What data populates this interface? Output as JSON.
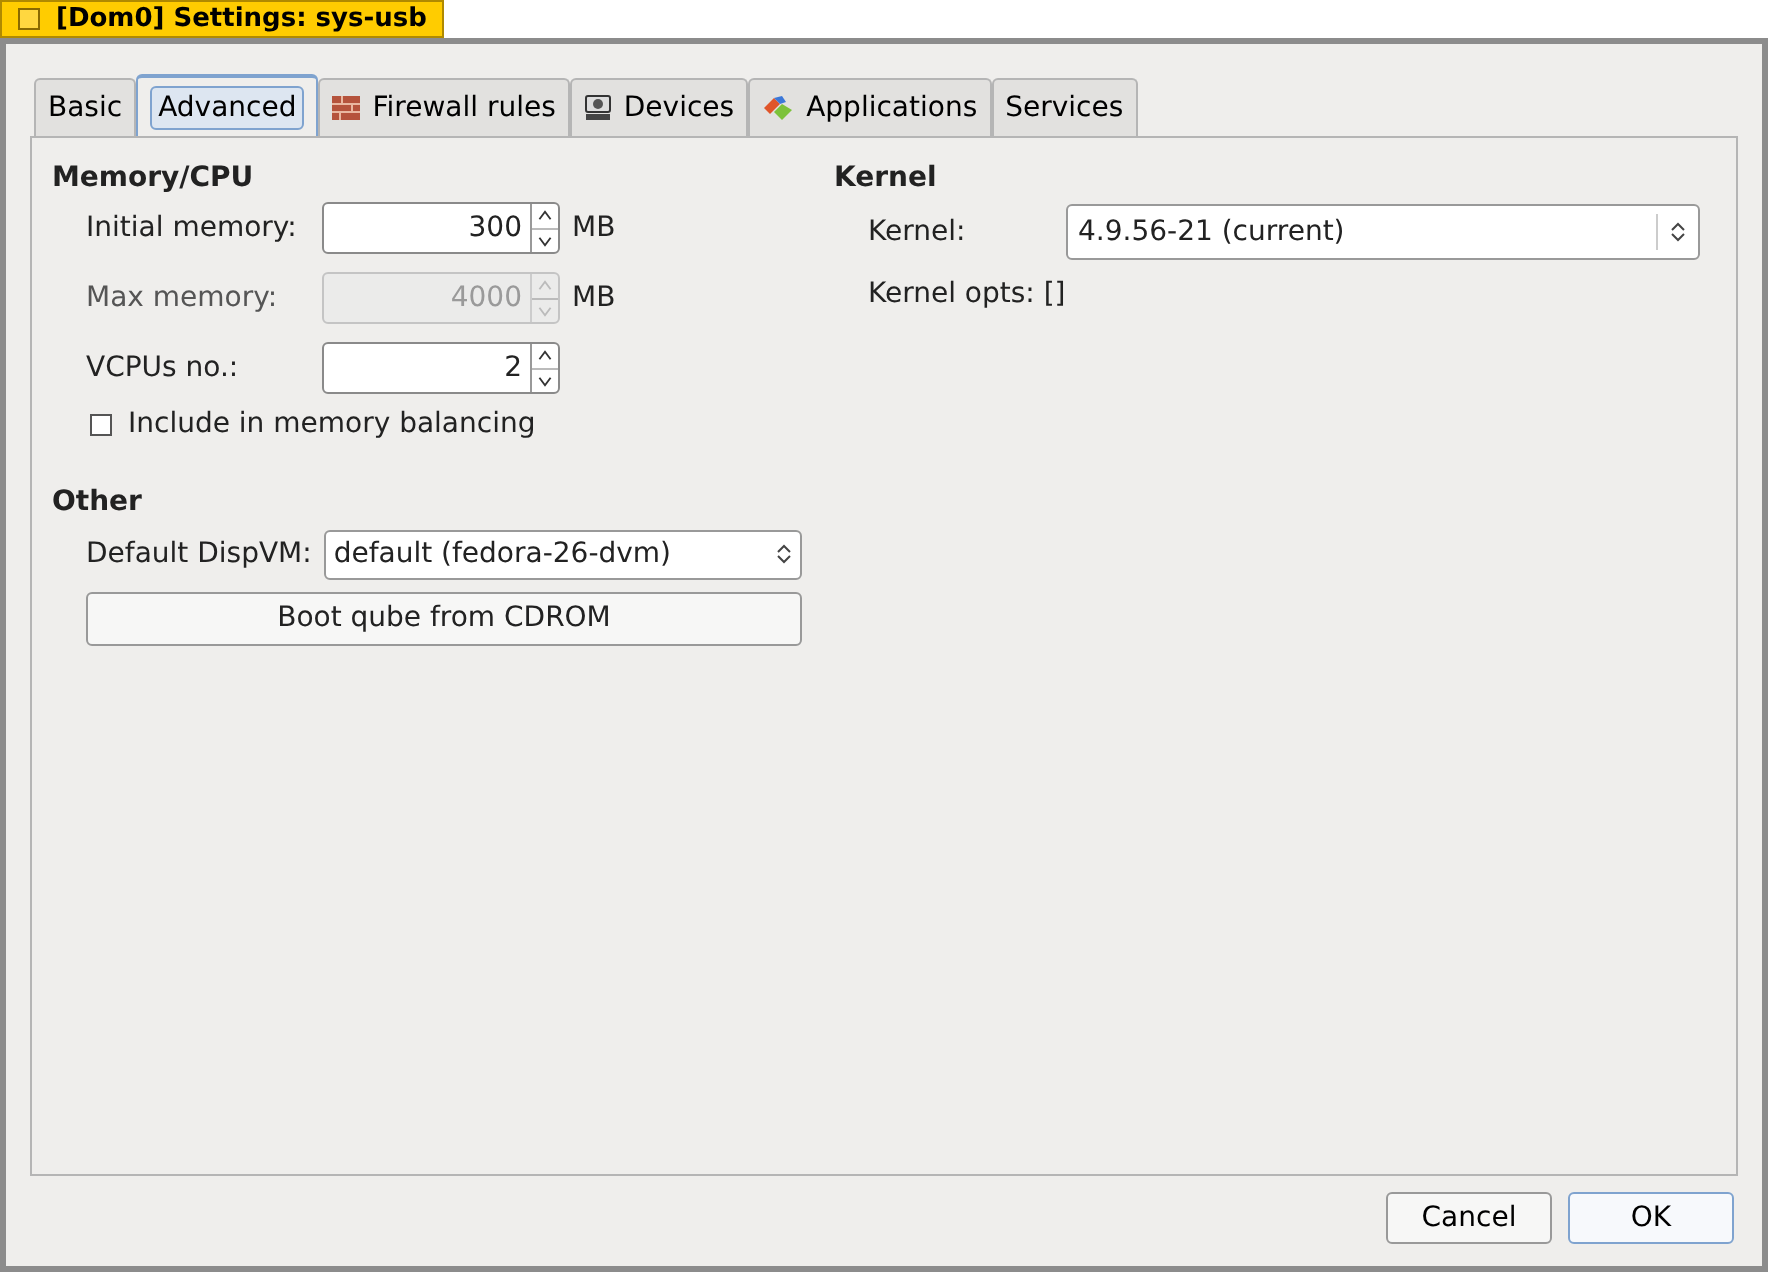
{
  "window": {
    "title": "[Dom0] Settings: sys-usb"
  },
  "tabs": [
    {
      "label": "Basic",
      "selected": false,
      "kind": "plain"
    },
    {
      "label": "Advanced",
      "selected": true,
      "kind": "plain"
    },
    {
      "label": "Firewall rules",
      "selected": false,
      "kind": "firewall"
    },
    {
      "label": "Devices",
      "selected": false,
      "kind": "devices"
    },
    {
      "label": "Applications",
      "selected": false,
      "kind": "applications"
    },
    {
      "label": "Services",
      "selected": false,
      "kind": "plain"
    }
  ],
  "memory_cpu": {
    "heading": "Memory/CPU",
    "fields": [
      {
        "label": "Initial memory:",
        "value": "300",
        "unit": "MB",
        "disabled": false
      },
      {
        "label": "Max memory:",
        "value": "4000",
        "unit": "MB",
        "disabled": true
      },
      {
        "label": "VCPUs no.:",
        "value": "2",
        "disabled": false
      }
    ],
    "balancing": {
      "label": "Include in memory balancing",
      "checked": false
    }
  },
  "other": {
    "heading": "Other",
    "dispvm": {
      "label": "Default DispVM:",
      "value": "default (fedora-26-dvm)"
    },
    "boot_button": "Boot qube from CDROM"
  },
  "kernel": {
    "heading": "Kernel",
    "kernel": {
      "label": "Kernel:",
      "value": "4.9.56-21 (current)"
    },
    "opts": "Kernel opts: []"
  },
  "buttons": [
    {
      "label": "Cancel",
      "default": false
    },
    {
      "label": "OK",
      "default": true
    }
  ]
}
